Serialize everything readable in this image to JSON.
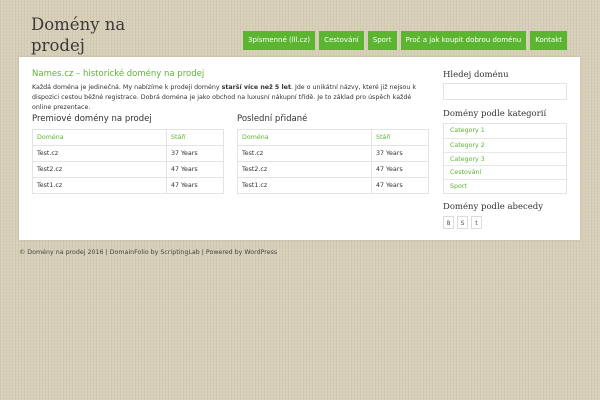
{
  "header": {
    "site_title": "Domény na prodej",
    "nav": [
      "3písmenné (lll.cz)",
      "Cestování",
      "Sport",
      "Proč a jak koupit dobrou doménu",
      "Kontakt"
    ]
  },
  "main": {
    "intro_title": "Names.cz – historické domény na prodej",
    "intro_text_before": "Každá doména je jedinečná. My nabízíme k prodeji domény ",
    "intro_text_bold": "starší více než 5 let",
    "intro_text_after": ". Jde o unikátní názvy, které již nejsou k dispozici cestou běžné registrace. Dobrá doména je jako obchod na luxusní nákupní třídě. Je to základ pro úspěch každé online prezentace.",
    "premium": {
      "title": "Premiové domény na prodej",
      "headers": [
        "Doména",
        "Stáří"
      ],
      "rows": [
        [
          "Test.cz",
          "37 Years"
        ],
        [
          "Test2.cz",
          "47 Years"
        ],
        [
          "Test1.cz",
          "47 Years"
        ]
      ]
    },
    "recent": {
      "title": "Poslední přidané",
      "headers": [
        "Doména",
        "Stáří"
      ],
      "rows": [
        [
          "Test.cz",
          "37 Years"
        ],
        [
          "Test2.cz",
          "47 Years"
        ],
        [
          "Test1.cz",
          "47 Years"
        ]
      ]
    }
  },
  "sidebar": {
    "search_title": "Hledej doménu",
    "categories_title": "Domény podle kategorií",
    "categories": [
      "Category 1",
      "Category 2",
      "Category 3",
      "Cestování",
      "Sport"
    ],
    "alphabet_title": "Domény podle abecedy",
    "letters": [
      "8",
      "S",
      "t"
    ]
  },
  "footer": {
    "text": "© Domény na prodej 2016 | DomainFolio by ScriptingLab | Powered by WordPress"
  },
  "colors": {
    "accent": "#5cb531",
    "background": "#d8cfb8"
  }
}
